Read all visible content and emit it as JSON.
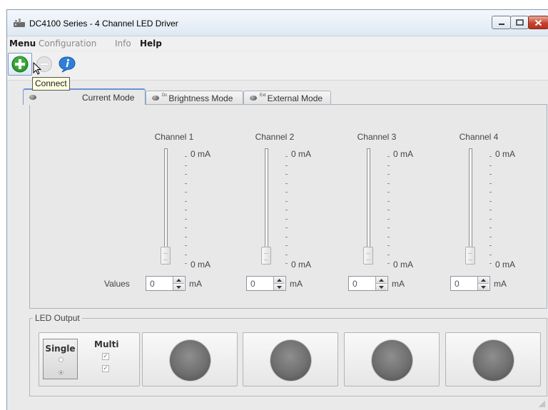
{
  "window": {
    "title": "DC4100 Series - 4 Channel LED Driver",
    "buttons": [
      "minimize-icon",
      "maximize-icon",
      "close-icon"
    ]
  },
  "menu": {
    "menu": "Menu",
    "configuration": "Configuration",
    "info": "Info",
    "help": "Help"
  },
  "toolbar": {
    "connect_icon": "plus-circle-icon",
    "disconnect_icon": "minus-circle-icon",
    "info_icon": "info-bubble-icon",
    "tooltip": "Connect"
  },
  "tabs": {
    "current": "Current Mode",
    "brightness_sup": "Dc",
    "brightness": "Brightness Mode",
    "external_sup": "Ext",
    "external": "External Mode"
  },
  "channels": [
    {
      "title": "Channel 1",
      "max_label": "0 mA",
      "min_label": "0 mA",
      "value": "0",
      "unit": "mA"
    },
    {
      "title": "Channel 2",
      "max_label": "0 mA",
      "min_label": "0 mA",
      "value": "0",
      "unit": "mA"
    },
    {
      "title": "Channel 3",
      "max_label": "0 mA",
      "min_label": "0 mA",
      "value": "0",
      "unit": "mA"
    },
    {
      "title": "Channel 4",
      "max_label": "0 mA",
      "min_label": "0 mA",
      "value": "0",
      "unit": "mA"
    }
  ],
  "values_label": "Values",
  "led_output": {
    "legend": "LED Output",
    "single": "Single",
    "multi": "Multi",
    "check_mark": "✓"
  },
  "colors": {
    "tab_accent": "#6a93d4",
    "led_off": "#6f6f6f",
    "close_button": "#c6432f",
    "connect_green": "#2e9a2e"
  }
}
